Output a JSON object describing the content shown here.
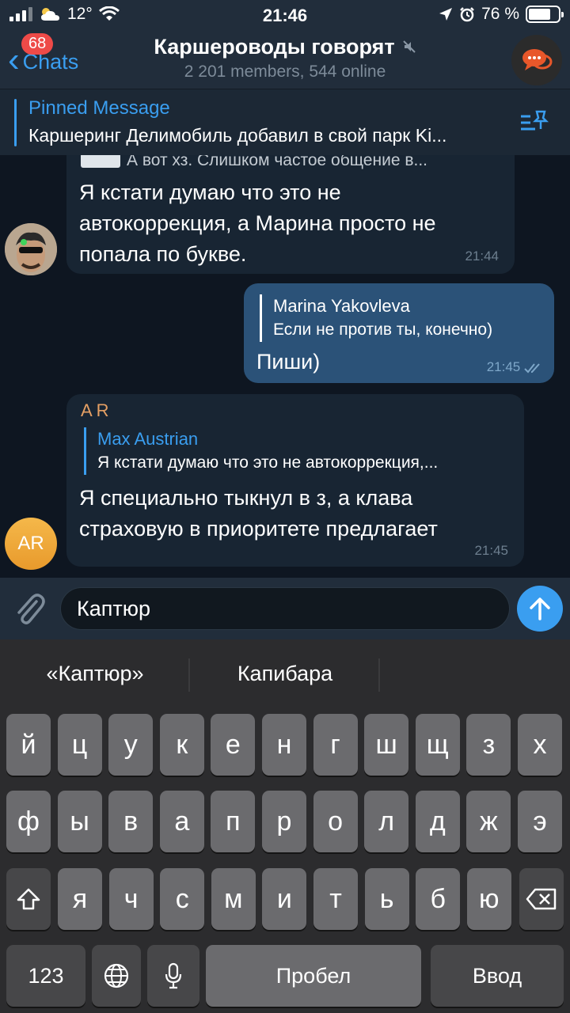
{
  "status_bar": {
    "temperature": "12°",
    "time": "21:46",
    "battery": "76 %",
    "battery_level": 0.76
  },
  "header": {
    "back_label": "Chats",
    "unread_badge": "68",
    "title": "Каршероводы говорят",
    "subtitle": "2 201 members, 544 online"
  },
  "pinned": {
    "label": "Pinned Message",
    "text": "Каршеринг Делимобиль добавил в свой парк Ki..."
  },
  "messages": [
    {
      "partial_reply_text": "А вот хз. Слишком частое общение в...",
      "text_lines": [
        "Я кстати думаю что это не",
        "автокоррекция, а Марина просто не",
        "попала по букве."
      ],
      "time": "21:44"
    },
    {
      "reply_name": "Marina Yakovleva",
      "reply_text": "Если не против ты, конечно)",
      "text": "Пиши)",
      "time": "21:45"
    },
    {
      "sender": "A R",
      "avatar_initials": "AR",
      "reply_name": "Max Austrian",
      "reply_text": "Я кстати думаю что это не автокоррекция,...",
      "text_lines": [
        "Я специально тыкнул в з, а клава",
        "страховую в приоритете предлагает"
      ],
      "time": "21:45"
    }
  ],
  "input": {
    "value": "Каптюр"
  },
  "keyboard": {
    "suggestions": [
      "«Каптюр»",
      "Капибара"
    ],
    "row1": [
      "й",
      "ц",
      "у",
      "к",
      "е",
      "н",
      "г",
      "ш",
      "щ",
      "з",
      "х"
    ],
    "row2": [
      "ф",
      "ы",
      "в",
      "а",
      "п",
      "р",
      "о",
      "л",
      "д",
      "ж",
      "э"
    ],
    "row3": [
      "я",
      "ч",
      "с",
      "м",
      "и",
      "т",
      "ь",
      "б",
      "ю"
    ],
    "numbers_key": "123",
    "space_key": "Пробел",
    "return_key": "Ввод"
  },
  "colors": {
    "accent": "#3a9ef0",
    "incoming_bubble": "#182533",
    "outgoing_bubble": "#2b5278",
    "sender_name": "#e5a064",
    "badge": "#ee4a48"
  }
}
